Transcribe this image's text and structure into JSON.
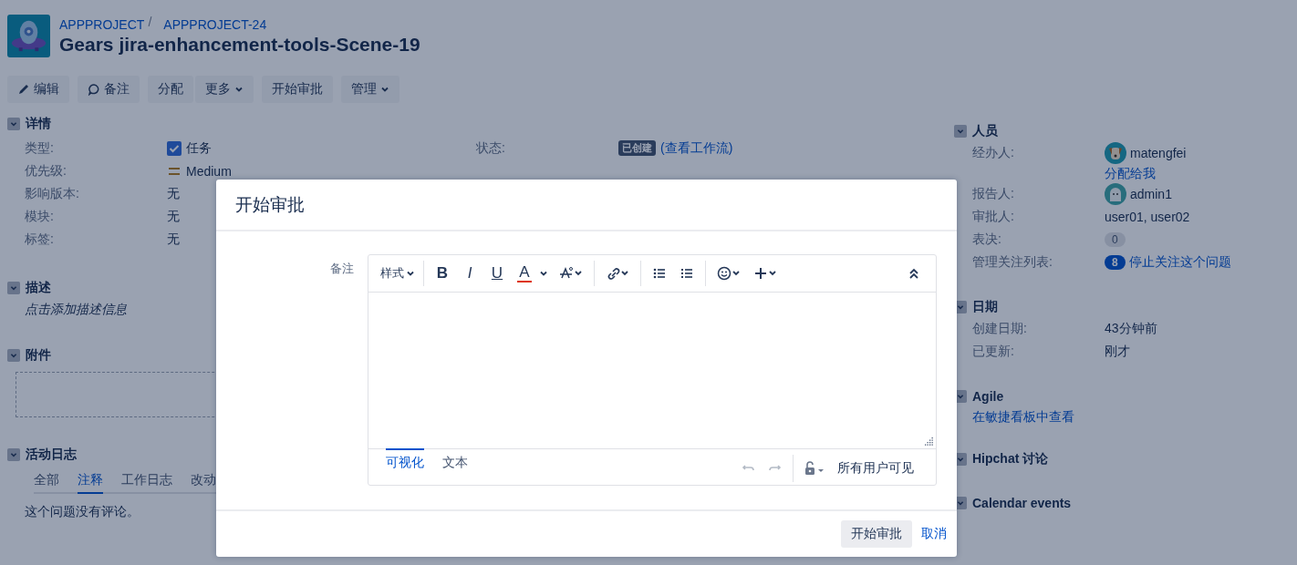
{
  "header": {
    "breadcrumbs": [
      "APPPROJECT",
      "APPPROJECT-24"
    ],
    "title": "Gears jira-enhancement-tools-Scene-19"
  },
  "toolbar": [
    [
      {
        "label": "编辑",
        "kind": "edit",
        "dropdown": false
      }
    ],
    [
      {
        "label": "备注",
        "kind": "comment",
        "dropdown": false
      }
    ],
    [
      {
        "label": "分配",
        "kind": "plain",
        "dropdown": false
      },
      {
        "label": "更多",
        "kind": "plain",
        "dropdown": true
      }
    ],
    [
      {
        "label": "开始审批",
        "kind": "plain",
        "dropdown": false
      }
    ],
    [
      {
        "label": "管理",
        "kind": "plain",
        "dropdown": true
      }
    ]
  ],
  "details": {
    "title": "详情",
    "expanded": true,
    "left": [
      {
        "label": "类型:",
        "kind": "type",
        "value": "任务"
      },
      {
        "label": "优先级:",
        "kind": "priority",
        "value": "Medium"
      },
      {
        "label": "影响版本:",
        "kind": "text",
        "value": "无"
      },
      {
        "label": "模块:",
        "kind": "text",
        "value": "无"
      },
      {
        "label": "标签:",
        "kind": "text",
        "value": "无"
      }
    ],
    "right": [
      {
        "label": "状态:",
        "kind": "status",
        "value": "已创建",
        "link": "(查看工作流)"
      }
    ]
  },
  "description": {
    "title": "描述",
    "expanded": true,
    "prompt": "点击添加描述信息"
  },
  "attachments": {
    "title": "附件",
    "expanded": true
  },
  "activity": {
    "title": "活动日志",
    "expanded": true,
    "tabs": [
      {
        "label": "全部",
        "selected": false
      },
      {
        "label": "注释",
        "selected": true
      },
      {
        "label": "工作日志",
        "selected": false
      },
      {
        "label": "改动",
        "selected": false
      }
    ],
    "empty_text": "这个问题没有评论。"
  },
  "sidebar": [
    {
      "title": "人员",
      "expanded": true,
      "rows": [
        {
          "label": "经办人:",
          "kind": "user",
          "value": "matengfei",
          "link": "分配给我"
        },
        {
          "label": "报告人:",
          "kind": "user",
          "value": "admin1"
        },
        {
          "label": "审批人:",
          "kind": "text",
          "value": "user01, user02"
        },
        {
          "label": "表决:",
          "kind": "count",
          "value": "0"
        },
        {
          "label": "管理关注列表:",
          "kind": "watch",
          "value": "8",
          "link": "停止关注这个问题"
        }
      ]
    },
    {
      "title": "日期",
      "expanded": true,
      "rows": [
        {
          "label": "创建日期:",
          "kind": "text",
          "value": "43分钟前"
        },
        {
          "label": "已更新:",
          "kind": "text",
          "value": "刚才"
        }
      ]
    },
    {
      "title": "Agile",
      "expanded": true,
      "link": "在敏捷看板中查看"
    },
    {
      "title": "Hipchat 讨论",
      "expanded": true
    },
    {
      "title": "Calendar events",
      "expanded": true
    }
  ],
  "dialog": {
    "title": "开始审批",
    "field_label": "备注",
    "editor_toolbar": [
      [
        {
          "kind": "style",
          "label": "样式"
        }
      ],
      [
        {
          "kind": "bold",
          "label": "B"
        },
        {
          "kind": "italic",
          "label": "I"
        },
        {
          "kind": "underline",
          "label": "U"
        },
        {
          "kind": "color",
          "label": "A"
        },
        {
          "kind": "effects"
        }
      ],
      [
        {
          "kind": "link"
        }
      ],
      [
        {
          "kind": "bullets"
        },
        {
          "kind": "numbers"
        }
      ],
      [
        {
          "kind": "emoji"
        },
        {
          "kind": "insert"
        }
      ]
    ],
    "editor_tabs": [
      {
        "label": "可视化",
        "selected": true
      },
      {
        "label": "文本",
        "selected": false
      }
    ],
    "visibility": "所有用户可见",
    "submit": "开始审批",
    "cancel": "取消"
  }
}
